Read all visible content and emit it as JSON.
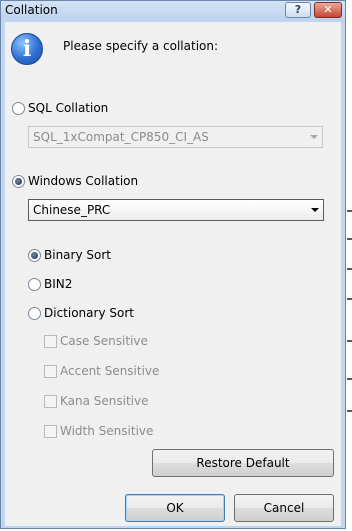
{
  "window": {
    "title": "Collation",
    "help_icon": "?",
    "close_icon": "✕"
  },
  "dialog": {
    "info_icon": "i",
    "prompt": "Please specify a collation:"
  },
  "sql_collation": {
    "label": "SQL Collation",
    "selected": false,
    "value": "SQL_1xCompat_CP850_CI_AS",
    "enabled": false
  },
  "windows_collation": {
    "label": "Windows Collation",
    "selected": true,
    "value": "Chinese_PRC",
    "enabled": true
  },
  "sort_options": [
    {
      "label": "Binary Sort",
      "selected": true
    },
    {
      "label": "BIN2",
      "selected": false
    },
    {
      "label": "Dictionary Sort",
      "selected": false
    }
  ],
  "sensitivity": [
    {
      "label": "Case Sensitive",
      "checked": false
    },
    {
      "label": "Accent Sensitive",
      "checked": false
    },
    {
      "label": "Kana Sensitive",
      "checked": false
    },
    {
      "label": "Width Sensitive",
      "checked": false
    }
  ],
  "buttons": {
    "restore_default": "Restore Default",
    "ok": "OK",
    "cancel": "Cancel"
  }
}
